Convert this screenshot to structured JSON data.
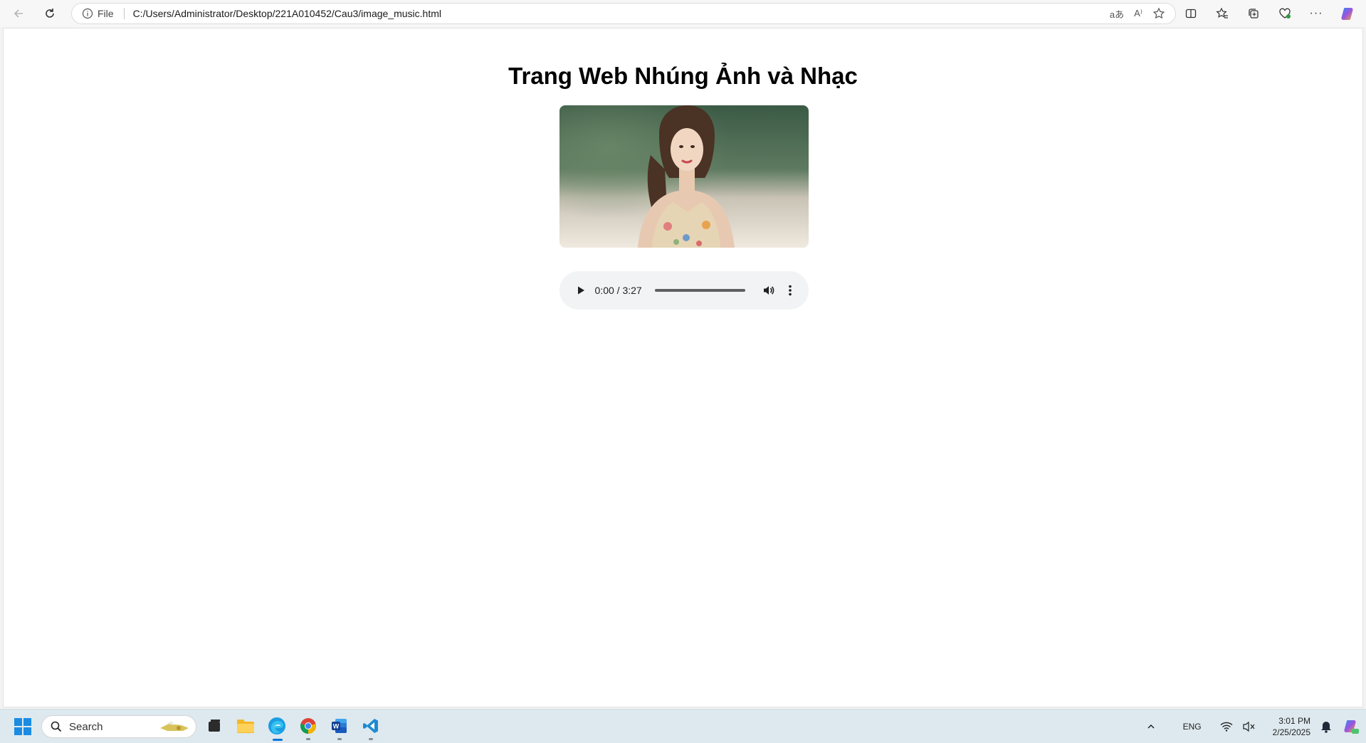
{
  "browser": {
    "address_prefix": "File",
    "url": "C:/Users/Administrator/Desktop/221A010452/Cau3/image_music.html"
  },
  "page": {
    "title": "Trang Web Nhúng Ảnh và Nhạc",
    "audio": {
      "time_display": "0:00 / 3:27"
    }
  },
  "taskbar": {
    "search_placeholder": "Search",
    "language": "ENG",
    "time": "3:01 PM",
    "date": "2/25/2025"
  }
}
